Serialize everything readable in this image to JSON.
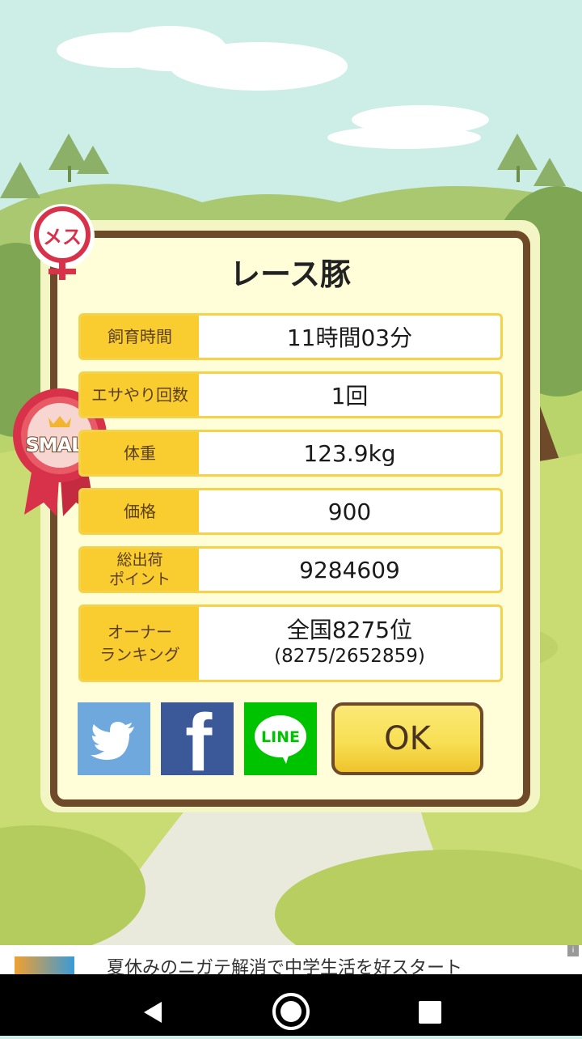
{
  "dialog": {
    "title": "レース豚",
    "gender_badge": "メス",
    "size_badge": "SMALL",
    "rows": [
      {
        "label": "飼育時間",
        "value": "11時間03分"
      },
      {
        "label": "エサやり回数",
        "value": "1回"
      },
      {
        "label": "体重",
        "value": "123.9kg"
      },
      {
        "label": "価格",
        "value": "900"
      },
      {
        "label": "総出荷\nポイント",
        "value": "9284609"
      }
    ],
    "ranking": {
      "label": "オーナー\nランキング",
      "value": "全国8275位",
      "detail": "(8275/2652859)"
    },
    "share": {
      "line_label": "LINE",
      "facebook_glyph": "f"
    },
    "ok_label": "OK"
  },
  "ad": {
    "text": "夏休みのニガテ解消で中学生活を好スタート"
  },
  "colors": {
    "twitter": "#6fa8dc",
    "facebook": "#3b5998",
    "line": "#00c300",
    "frame": "#6e4a2a",
    "label_bg": "#f9cc30"
  },
  "icons": [
    "female-icon",
    "ribbon-icon",
    "twitter-icon",
    "facebook-icon",
    "line-icon",
    "back-icon",
    "home-icon",
    "recents-icon"
  ]
}
